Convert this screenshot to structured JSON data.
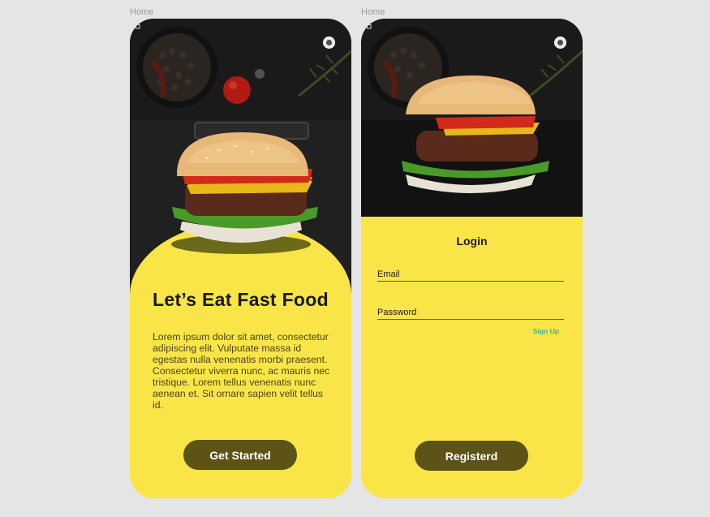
{
  "frames": [
    {
      "label": "Home",
      "title": "Let’s Eat Fast Food",
      "description": "Lorem ipsum dolor sit amet, consectetur adipiscing elit. Vulputate massa id egestas nulla venenatis morbi praesent. Consectetur viverra nunc, ac mauris nec tristique. Lorem tellus venenatis nunc aenean et. Sit ornare sapien velit tellus id.",
      "button_label": "Get Started"
    },
    {
      "label": "Home",
      "login_title": "Login",
      "email_label": "Email",
      "password_label": "Password",
      "signup_label": "Sign Up",
      "button_label": "Registerd"
    }
  ],
  "icons": {
    "menu": "grid-icon",
    "profile": "avatar"
  },
  "colors": {
    "accent_yellow": "#f9e547",
    "button_olive": "#5e5317",
    "dark_background": "#191919",
    "signup_teal": "#3ab0a0"
  }
}
